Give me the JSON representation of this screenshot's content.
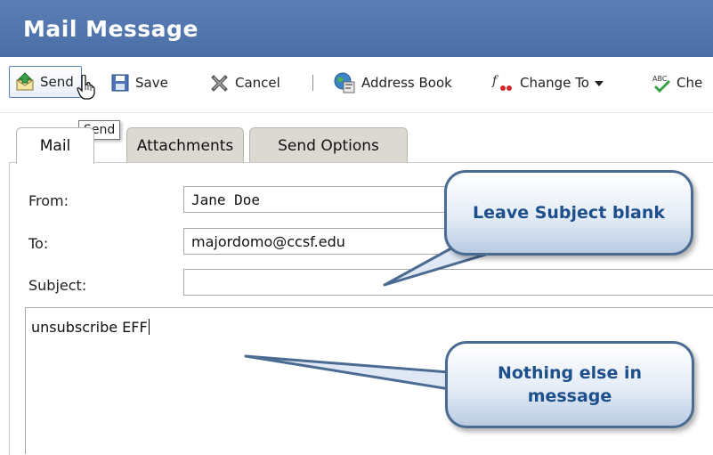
{
  "window": {
    "title": "Mail Message"
  },
  "toolbar": {
    "send": "Send",
    "save": "Save",
    "cancel": "Cancel",
    "address_book": "Address Book",
    "change_to": "Change To",
    "check_spelling_partial": "Che"
  },
  "tooltip": "Send",
  "tabs": [
    "Mail",
    "Attachments",
    "Send Options"
  ],
  "form": {
    "from_label": "From:",
    "from_value": "Jane Doe",
    "to_label": "To:",
    "to_value": "majordomo@ccsf.edu",
    "subject_label": "Subject:",
    "subject_value": "",
    "body": "unsubscribe EFF"
  },
  "callouts": {
    "subject_note": "Leave Subject blank",
    "body_note": "Nothing else in message"
  },
  "colors": {
    "titlebar": "#4a6ea6",
    "callout_text": "#1c4f8c",
    "callout_border": "#4a6c93"
  }
}
